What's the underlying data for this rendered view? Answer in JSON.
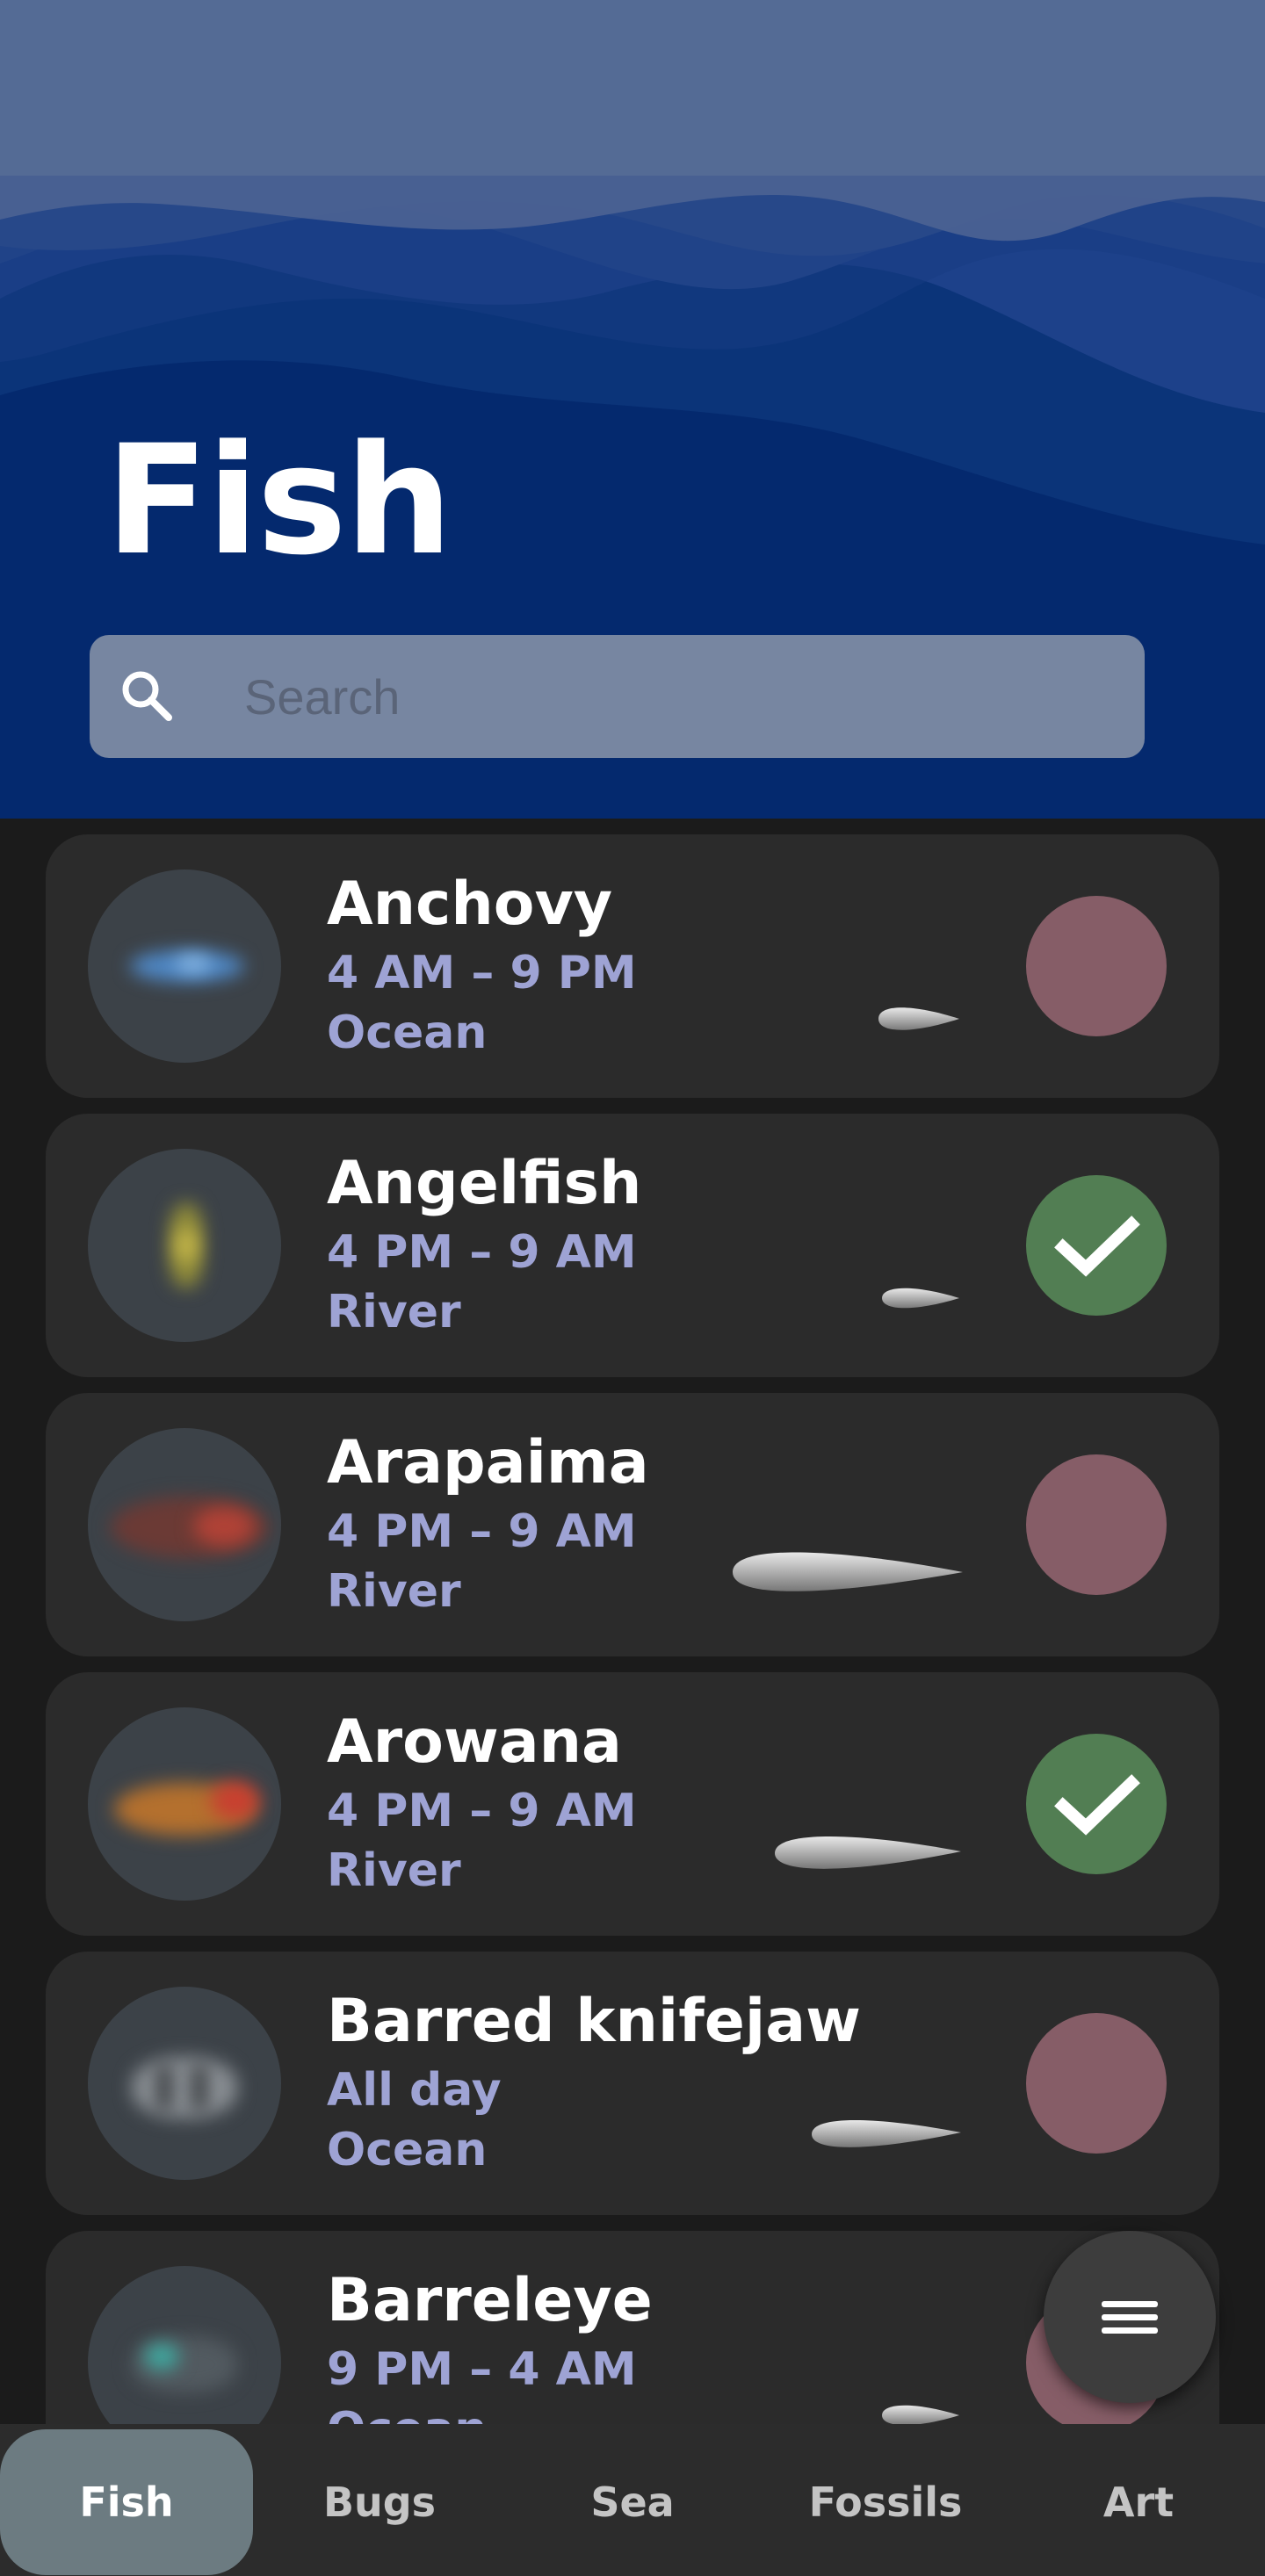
{
  "header": {
    "title": "Fish",
    "search_placeholder": "Search",
    "search_value": ""
  },
  "fish": [
    {
      "name": "Anchovy",
      "time": "4 AM – 9 PM",
      "location": "Ocean",
      "caught": false,
      "icon": "anchovy-icon"
    },
    {
      "name": "Angelfish",
      "time": "4 PM – 9 AM",
      "location": "River",
      "caught": true,
      "icon": "angelfish-icon"
    },
    {
      "name": "Arapaima",
      "time": "4 PM – 9 AM",
      "location": "River",
      "caught": false,
      "icon": "arapaima-icon"
    },
    {
      "name": "Arowana",
      "time": "4 PM – 9 AM",
      "location": "River",
      "caught": true,
      "icon": "arowana-icon"
    },
    {
      "name": "Barred knifejaw",
      "time": "All day",
      "location": "Ocean",
      "caught": false,
      "icon": "barred-knifejaw-icon"
    },
    {
      "name": "Barreleye",
      "time": "9 PM – 4 AM",
      "location": "Ocean",
      "caught": false,
      "icon": "barreleye-icon"
    }
  ],
  "nav": {
    "tabs": [
      "Fish",
      "Bugs",
      "Sea",
      "Fossils",
      "Art"
    ],
    "active": "Fish"
  },
  "colors": {
    "header_bg": "#04296e",
    "card_bg": "#2b2b2b",
    "subtitle": "#9ea3d4",
    "unchecked": "#865d67",
    "checked": "#527e53",
    "active_tab": "#6c7b81"
  },
  "fab_icon": "menu-icon"
}
